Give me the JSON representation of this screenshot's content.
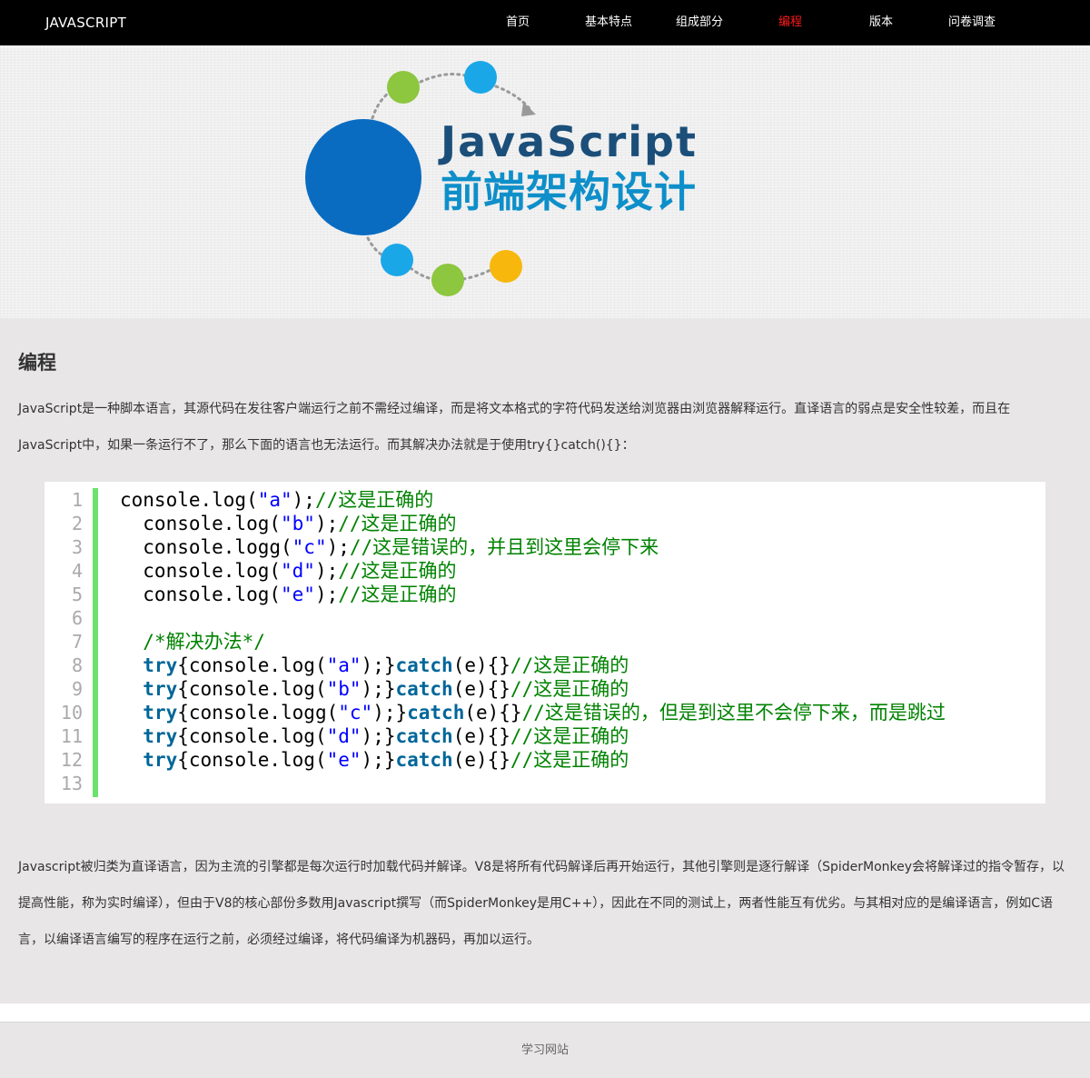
{
  "nav": {
    "brand": "JAVASCRIPT",
    "items": [
      {
        "label": "首页",
        "active": false
      },
      {
        "label": "基本特点",
        "active": false
      },
      {
        "label": "组成部分",
        "active": false
      },
      {
        "label": "编程",
        "active": true
      },
      {
        "label": "版本",
        "active": false
      },
      {
        "label": "问卷调查",
        "active": false
      }
    ]
  },
  "banner": {
    "title_en": "JavaScript",
    "title_cn": "前端架构设计",
    "colors": {
      "dark_blue": "#0a6cc1",
      "light_blue": "#1aa7e8",
      "green": "#8dc63f",
      "yellow": "#f7b70d",
      "text": "#0e5a8c"
    }
  },
  "main": {
    "title": "编程",
    "para1": "JavaScript是一种脚本语言，其源代码在发往客户端运行之前不需经过编译，而是将文本格式的字符代码发送给浏览器由浏览器解释运行。直译语言的弱点是安全性较差，而且在JavaScript中，如果一条运行不了，那么下面的语言也无法运行。而其解决办法就是于使用try{}catch(){}：",
    "code": {
      "line_numbers": [
        "1",
        "2",
        "3",
        "4",
        "5",
        "6",
        "7",
        "8",
        "9",
        "10",
        "11",
        "12",
        "13"
      ],
      "lines": [
        [
          {
            "t": "console.log(",
            "c": "pl"
          },
          {
            "t": "\"a\"",
            "c": "str"
          },
          {
            "t": ");",
            "c": "pl"
          },
          {
            "t": "//这是正确的",
            "c": "cm"
          }
        ],
        [
          {
            "t": "  console.log(",
            "c": "pl"
          },
          {
            "t": "\"b\"",
            "c": "str"
          },
          {
            "t": ");",
            "c": "pl"
          },
          {
            "t": "//这是正确的",
            "c": "cm"
          }
        ],
        [
          {
            "t": "  console.logg(",
            "c": "pl"
          },
          {
            "t": "\"c\"",
            "c": "str"
          },
          {
            "t": ");",
            "c": "pl"
          },
          {
            "t": "//这是错误的，并且到这里会停下来",
            "c": "cm"
          }
        ],
        [
          {
            "t": "  console.log(",
            "c": "pl"
          },
          {
            "t": "\"d\"",
            "c": "str"
          },
          {
            "t": ");",
            "c": "pl"
          },
          {
            "t": "//这是正确的",
            "c": "cm"
          }
        ],
        [
          {
            "t": "  console.log(",
            "c": "pl"
          },
          {
            "t": "\"e\"",
            "c": "str"
          },
          {
            "t": ");",
            "c": "pl"
          },
          {
            "t": "//这是正确的",
            "c": "cm"
          }
        ],
        [
          {
            "t": "",
            "c": "pl"
          }
        ],
        [
          {
            "t": "  ",
            "c": "pl"
          },
          {
            "t": "/*解决办法*/",
            "c": "cm"
          }
        ],
        [
          {
            "t": "  ",
            "c": "pl"
          },
          {
            "t": "try",
            "c": "kw"
          },
          {
            "t": "{console.log(",
            "c": "pl"
          },
          {
            "t": "\"a\"",
            "c": "str"
          },
          {
            "t": ");}",
            "c": "pl"
          },
          {
            "t": "catch",
            "c": "kw"
          },
          {
            "t": "(e){}",
            "c": "pl"
          },
          {
            "t": "//这是正确的",
            "c": "cm"
          }
        ],
        [
          {
            "t": "  ",
            "c": "pl"
          },
          {
            "t": "try",
            "c": "kw"
          },
          {
            "t": "{console.log(",
            "c": "pl"
          },
          {
            "t": "\"b\"",
            "c": "str"
          },
          {
            "t": ");}",
            "c": "pl"
          },
          {
            "t": "catch",
            "c": "kw"
          },
          {
            "t": "(e){}",
            "c": "pl"
          },
          {
            "t": "//这是正确的",
            "c": "cm"
          }
        ],
        [
          {
            "t": "  ",
            "c": "pl"
          },
          {
            "t": "try",
            "c": "kw"
          },
          {
            "t": "{console.logg(",
            "c": "pl"
          },
          {
            "t": "\"c\"",
            "c": "str"
          },
          {
            "t": ");}",
            "c": "pl"
          },
          {
            "t": "catch",
            "c": "kw"
          },
          {
            "t": "(e){}",
            "c": "pl"
          },
          {
            "t": "//这是错误的，但是到这里不会停下来，而是跳过",
            "c": "cm"
          }
        ],
        [
          {
            "t": "  ",
            "c": "pl"
          },
          {
            "t": "try",
            "c": "kw"
          },
          {
            "t": "{console.log(",
            "c": "pl"
          },
          {
            "t": "\"d\"",
            "c": "str"
          },
          {
            "t": ");}",
            "c": "pl"
          },
          {
            "t": "catch",
            "c": "kw"
          },
          {
            "t": "(e){}",
            "c": "pl"
          },
          {
            "t": "//这是正确的",
            "c": "cm"
          }
        ],
        [
          {
            "t": "  ",
            "c": "pl"
          },
          {
            "t": "try",
            "c": "kw"
          },
          {
            "t": "{console.log(",
            "c": "pl"
          },
          {
            "t": "\"e\"",
            "c": "str"
          },
          {
            "t": ");}",
            "c": "pl"
          },
          {
            "t": "catch",
            "c": "kw"
          },
          {
            "t": "(e){}",
            "c": "pl"
          },
          {
            "t": "//这是正确的",
            "c": "cm"
          }
        ],
        [
          {
            "t": "",
            "c": "pl"
          }
        ]
      ]
    },
    "para2": "Javascript被归类为直译语言，因为主流的引擎都是每次运行时加载代码并解译。V8是将所有代码解译后再开始运行，其他引擎则是逐行解译（SpiderMonkey会将解译过的指令暂存，以提高性能，称为实时编译），但由于V8的核心部份多数用Javascript撰写（而SpiderMonkey是用C++），因此在不同的测试上，两者性能互有优劣。与其相对应的是编译语言，例如C语言，以编译语言编写的程序在运行之前，必须经过编译，将代码编译为机器码，再加以运行。"
  },
  "footer": {
    "text": "学习网站"
  },
  "colors": {
    "nav_bg": "#000000",
    "nav_active": "#ff1a1a",
    "content_bg": "#e8e6e6",
    "gutter_bar": "#6ce26c",
    "keyword": "#006699",
    "string": "#0000ff",
    "comment": "#008200"
  }
}
